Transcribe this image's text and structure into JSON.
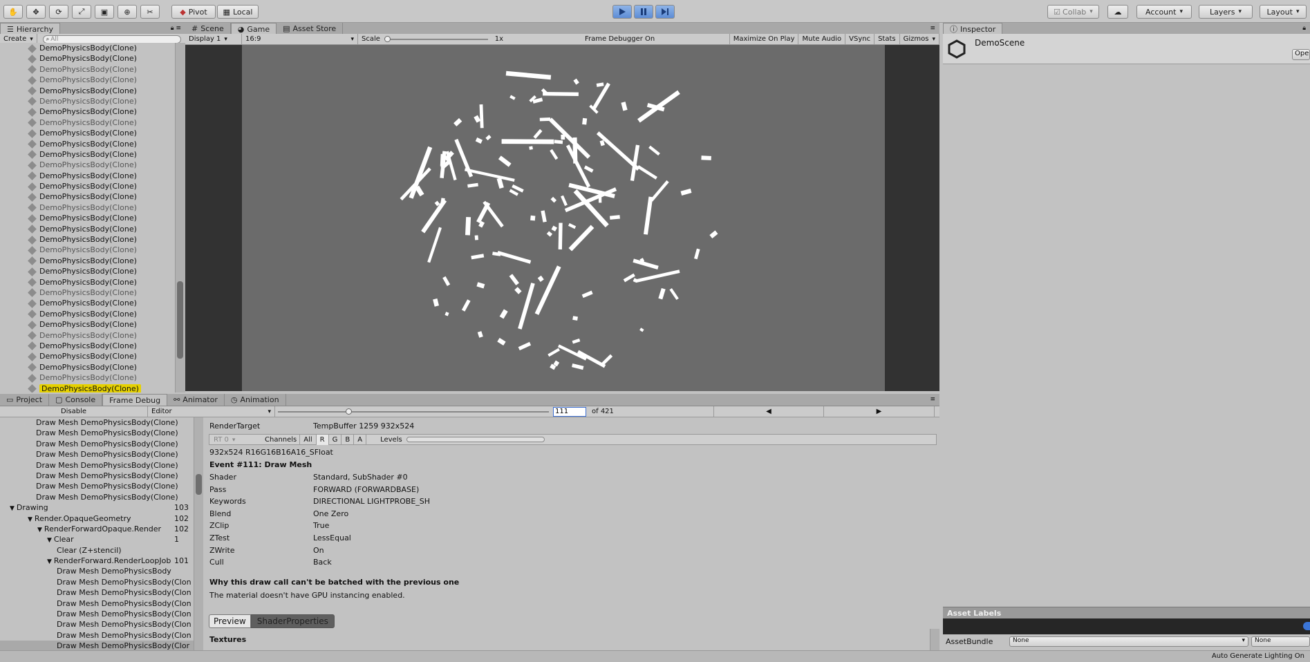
{
  "toolbar": {
    "pivot": "Pivot",
    "local": "Local",
    "collab": "Collab",
    "account": "Account",
    "layers": "Layers",
    "layout": "Layout"
  },
  "hierarchy": {
    "tab": "Hierarchy",
    "create": "Create",
    "search_placeholder": "All",
    "items": [
      "DemoPhysicsBody(Clone)",
      "DemoPhysicsBody(Clone)",
      "DemoPhysicsBody(Clone)",
      "DemoPhysicsBody(Clone)",
      "DemoPhysicsBody(Clone)",
      "DemoPhysicsBody(Clone)",
      "DemoPhysicsBody(Clone)",
      "DemoPhysicsBody(Clone)",
      "DemoPhysicsBody(Clone)",
      "DemoPhysicsBody(Clone)",
      "DemoPhysicsBody(Clone)",
      "DemoPhysicsBody(Clone)",
      "DemoPhysicsBody(Clone)",
      "DemoPhysicsBody(Clone)",
      "DemoPhysicsBody(Clone)",
      "DemoPhysicsBody(Clone)",
      "DemoPhysicsBody(Clone)",
      "DemoPhysicsBody(Clone)",
      "DemoPhysicsBody(Clone)",
      "DemoPhysicsBody(Clone)",
      "DemoPhysicsBody(Clone)",
      "DemoPhysicsBody(Clone)",
      "DemoPhysicsBody(Clone)",
      "DemoPhysicsBody(Clone)",
      "DemoPhysicsBody(Clone)",
      "DemoPhysicsBody(Clone)",
      "DemoPhysicsBody(Clone)",
      "DemoPhysicsBody(Clone)",
      "DemoPhysicsBody(Clone)",
      "DemoPhysicsBody(Clone)",
      "DemoPhysicsBody(Clone)",
      "DemoPhysicsBody(Clone)"
    ],
    "selected": "DemoPhysicsBody(Clone)"
  },
  "scene_tabs": {
    "scene": "Scene",
    "game": "Game",
    "asset_store": "Asset Store"
  },
  "game_bar": {
    "display": "Display 1",
    "aspect": "16:9",
    "scale_label": "Scale",
    "scale_value": "1x",
    "frame_debugger": "Frame Debugger On",
    "maximize": "Maximize On Play",
    "mute": "Mute Audio",
    "vsync": "VSync",
    "stats": "Stats",
    "gizmos": "Gizmos"
  },
  "inspector": {
    "tab": "Inspector",
    "object_name": "DemoScene",
    "open_button": "Ope",
    "asset_labels": "Asset Labels",
    "asset_bundle": "AssetBundle",
    "bundle_value": "None",
    "bundle_variant": "None"
  },
  "bottom_tabs": {
    "project": "Project",
    "console": "Console",
    "frame_debug": "Frame Debug",
    "animator": "Animator",
    "animation": "Animation"
  },
  "frame_debug": {
    "disable": "Disable",
    "editor": "Editor",
    "event_index": "111",
    "event_total": "of 421",
    "slider_fraction": 0.26,
    "tree": [
      {
        "label": "Draw Mesh DemoPhysicsBody(Clone)",
        "indent": 0,
        "count": ""
      },
      {
        "label": "Draw Mesh DemoPhysicsBody(Clone)",
        "indent": 0,
        "count": ""
      },
      {
        "label": "Draw Mesh DemoPhysicsBody(Clone)",
        "indent": 0,
        "count": ""
      },
      {
        "label": "Draw Mesh DemoPhysicsBody(Clone)",
        "indent": 0,
        "count": ""
      },
      {
        "label": "Draw Mesh DemoPhysicsBody(Clone)",
        "indent": 0,
        "count": ""
      },
      {
        "label": "Draw Mesh DemoPhysicsBody(Clone)",
        "indent": 0,
        "count": ""
      },
      {
        "label": "Draw Mesh DemoPhysicsBody(Clone)",
        "indent": 0,
        "count": ""
      },
      {
        "label": "Draw Mesh DemoPhysicsBody(Clone)",
        "indent": 0,
        "count": ""
      },
      {
        "label": "Drawing",
        "indent": -1,
        "count": "103",
        "arrow": true
      },
      {
        "label": "Render.OpaqueGeometry",
        "indent": 1,
        "count": "102",
        "arrow": true
      },
      {
        "label": "RenderForwardOpaque.Render",
        "indent": 2,
        "count": "102",
        "arrow": true
      },
      {
        "label": "Clear",
        "indent": 3,
        "count": "1",
        "arrow": true
      },
      {
        "label": "Clear (Z+stencil)",
        "indent": 4,
        "count": ""
      },
      {
        "label": "RenderForward.RenderLoopJob",
        "indent": 3,
        "count": "101",
        "arrow": true
      },
      {
        "label": "Draw Mesh DemoPhysicsBody",
        "indent": 4,
        "count": ""
      },
      {
        "label": "Draw Mesh DemoPhysicsBody(Clon",
        "indent": 4,
        "count": ""
      },
      {
        "label": "Draw Mesh DemoPhysicsBody(Clon",
        "indent": 4,
        "count": ""
      },
      {
        "label": "Draw Mesh DemoPhysicsBody(Clon",
        "indent": 4,
        "count": ""
      },
      {
        "label": "Draw Mesh DemoPhysicsBody(Clon",
        "indent": 4,
        "count": ""
      },
      {
        "label": "Draw Mesh DemoPhysicsBody(Clon",
        "indent": 4,
        "count": ""
      },
      {
        "label": "Draw Mesh DemoPhysicsBody(Clon",
        "indent": 4,
        "count": ""
      },
      {
        "label": "Draw Mesh DemoPhysicsBody(Clor",
        "indent": 4,
        "count": ""
      }
    ],
    "render_target_label": "RenderTarget",
    "render_target_value": "TempBuffer 1259 932x524",
    "rt0": "RT 0",
    "channels": "Channels",
    "ch_all": "All",
    "ch_r": "R",
    "ch_g": "G",
    "ch_b": "B",
    "ch_a": "A",
    "levels": "Levels",
    "format": "932x524 R16G16B16A16_SFloat",
    "event_title": "Event #111: Draw Mesh",
    "props": [
      {
        "k": "Shader",
        "v": "Standard, SubShader #0"
      },
      {
        "k": "Pass",
        "v": "FORWARD (FORWARDBASE)"
      },
      {
        "k": "Keywords",
        "v": "DIRECTIONAL LIGHTPROBE_SH"
      },
      {
        "k": "Blend",
        "v": "One Zero"
      },
      {
        "k": "ZClip",
        "v": "True"
      },
      {
        "k": "ZTest",
        "v": "LessEqual"
      },
      {
        "k": "ZWrite",
        "v": "On"
      },
      {
        "k": "Cull",
        "v": "Back"
      }
    ],
    "batch_title": "Why this draw call can't be batched with the previous one",
    "batch_reason": "The material doesn't have GPU instancing enabled.",
    "preview_tab": "Preview",
    "shaderprops_tab": "ShaderProperties",
    "textures": "Textures"
  },
  "status": {
    "lighting": "Auto Generate Lighting On"
  }
}
